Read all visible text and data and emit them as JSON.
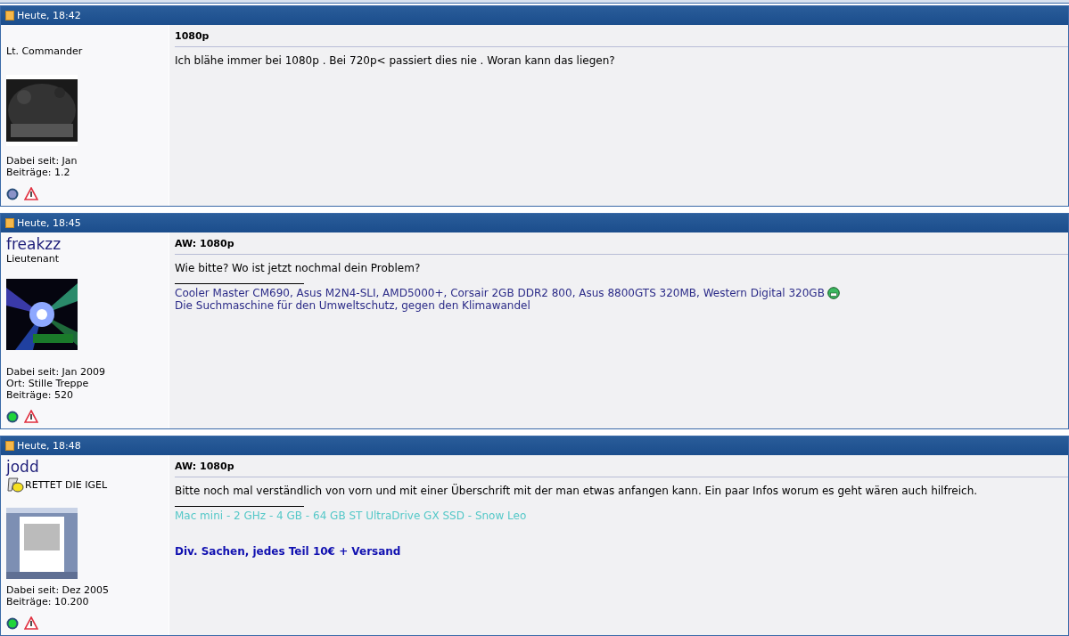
{
  "posts": [
    {
      "timestamp": "Heute, 18:42",
      "rank": "Lt. Commander",
      "avatar": {
        "kind": "picture"
      },
      "stats": [
        "Dabei seit: Jan",
        "Beiträge: 1.2"
      ],
      "online": false,
      "title": "1080p",
      "body": "Ich blähe immer bei 1080p . Bei 720p< passiert dies nie . Woran kann das liegen?"
    },
    {
      "timestamp": "Heute, 18:45",
      "username": "freakzz",
      "rank": "Lieutenant",
      "avatar": {
        "kind": "picture"
      },
      "stats": [
        "Dabei seit: Jan 2009",
        "Ort: Stille Treppe",
        "Beiträge: 520"
      ],
      "online": true,
      "title": "AW: 1080p",
      "body": "Wie bitte? Wo ist jetzt nochmal dein Problem?",
      "signature": [
        {
          "kind": "link",
          "text": "Cooler Master CM690, Asus M2N4-SLI, AMD5000+, Corsair 2GB DDR2 800, Asus 8800GTS 320MB, Western Digital 320GB",
          "emoji": true
        },
        {
          "kind": "link",
          "text": "Die Suchmaschine für den Umweltschutz, gegen den Klimawandel"
        }
      ]
    },
    {
      "timestamp": "Heute, 18:48",
      "username": "jodd",
      "rank": "RETTET DIE IGEL",
      "rank_icon": true,
      "avatar": {
        "kind": "picture"
      },
      "stats": [
        "Dabei seit: Dez 2005",
        "Beiträge: 10.200"
      ],
      "online": true,
      "title": "AW: 1080p",
      "body": "Bitte noch mal verständlich von vorn und mit einer Überschrift mit der man etwas anfangen kann. Ein paar Infos worum es geht wären auch hilfreich.",
      "signature": [
        {
          "kind": "faint",
          "text": "Mac mini - 2 GHz - 4 GB - 64 GB ST UltraDrive GX SSD - Snow Leo"
        },
        {
          "kind": "bold",
          "text": "Div. Sachen, jedes Teil 10€ + Versand"
        }
      ]
    }
  ]
}
